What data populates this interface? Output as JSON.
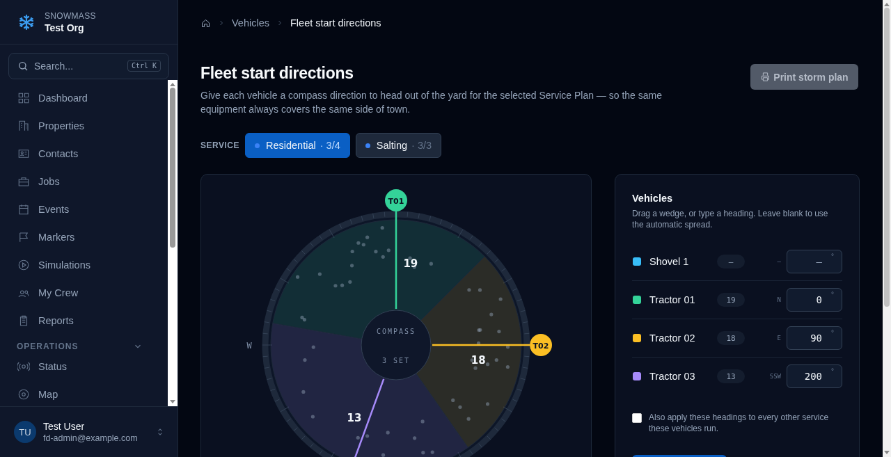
{
  "org": {
    "brand": "SNOWMASS",
    "name": "Test Org"
  },
  "search": {
    "placeholder": "Search...",
    "shortcut": "Ctrl K"
  },
  "nav": {
    "items": [
      "Dashboard",
      "Properties",
      "Contacts",
      "Jobs",
      "Events",
      "Markers",
      "Simulations",
      "My Crew",
      "Reports"
    ],
    "sections": [
      {
        "title": "OPERATIONS",
        "expanded": true,
        "items": [
          "Status",
          "Map"
        ]
      }
    ]
  },
  "user": {
    "initials": "TU",
    "name": "Test User",
    "email": "fd-admin@example.com"
  },
  "breadcrumb": [
    "Vehicles",
    "Fleet start directions"
  ],
  "page": {
    "title": "Fleet start directions",
    "description": "Give each vehicle a compass direction to head out of the yard for the selected Service Plan — so the same equipment always covers the same side of town.",
    "print_button": {
      "label": "Print storm plan",
      "disabled": true
    }
  },
  "service": {
    "label": "SERVICE",
    "tabs": [
      {
        "label": "Residential",
        "count": "· 3/4",
        "selected": true
      },
      {
        "label": "Salting",
        "count": "· 3/3",
        "selected": false
      }
    ]
  },
  "compass": {
    "center_title": "COMPASS",
    "center_status": "3 SET",
    "west_label": "W"
  },
  "vehicles_panel": {
    "title": "Vehicles",
    "hint": "Drag a wedge, or type a heading. Leave blank to use the automatic spread.",
    "vehicles": [
      {
        "name": "Shovel 1",
        "color": "#38bdf8",
        "count": "—",
        "direction": "–",
        "placeholder": "–",
        "unit": "°"
      },
      {
        "name": "Tractor 01",
        "color": "#34d399",
        "count": "19",
        "direction": "N",
        "heading": "0",
        "unit": "°",
        "tag": "T01",
        "wedge_count": "19"
      },
      {
        "name": "Tractor 02",
        "color": "#fbbf24",
        "count": "18",
        "direction": "E",
        "heading": "90",
        "unit": "°",
        "tag": "T02",
        "wedge_count": "18"
      },
      {
        "name": "Tractor 03",
        "color": "#a78bfa",
        "count": "13",
        "direction": "SSW",
        "heading": "200",
        "unit": "°",
        "wedge_count": "13"
      }
    ],
    "apply_all": {
      "label": "Also apply these headings to every other service these vehicles run.",
      "checked": false
    }
  }
}
